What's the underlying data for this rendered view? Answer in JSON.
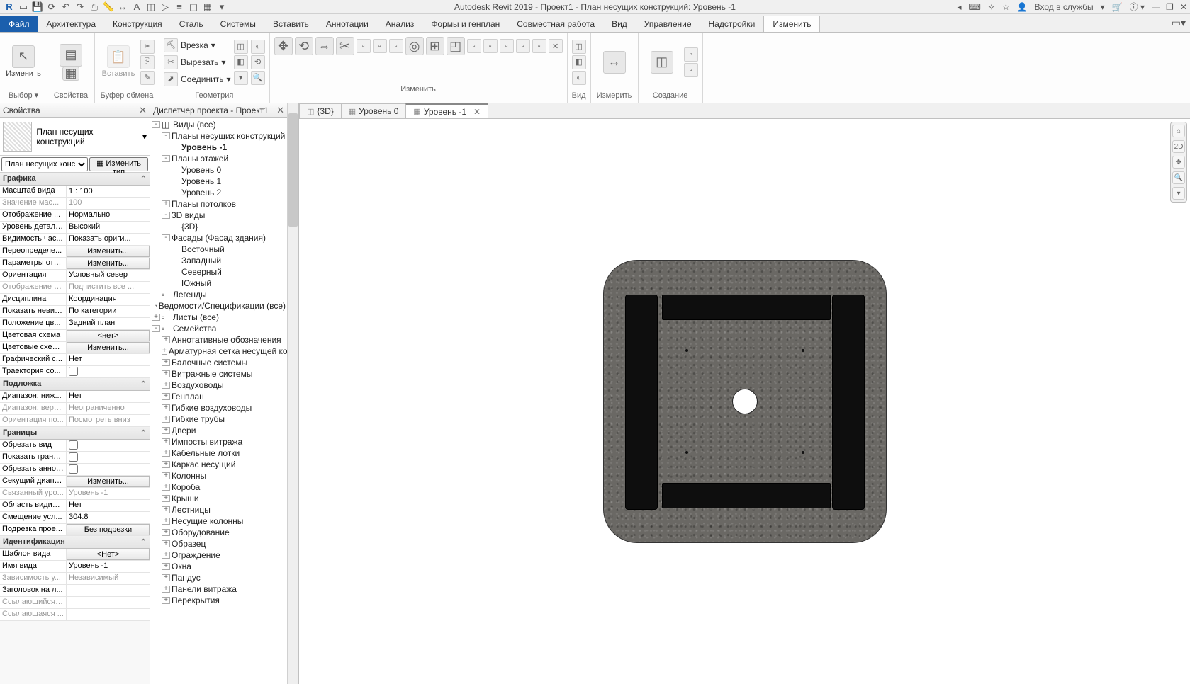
{
  "app": {
    "title": "Autodesk Revit 2019 - Проект1 - План несущих конструкций: Уровень -1",
    "sign_in": "Вход в службы"
  },
  "ribbon": {
    "file": "Файл",
    "tabs": [
      "Архитектура",
      "Конструкция",
      "Сталь",
      "Системы",
      "Вставить",
      "Аннотации",
      "Анализ",
      "Формы и генплан",
      "Совместная работа",
      "Вид",
      "Управление",
      "Надстройки",
      "Изменить"
    ],
    "active_tab": "Изменить",
    "groups": {
      "select": {
        "modify": "Изменить",
        "label": "Выбор"
      },
      "props": {
        "props": "Свойства",
        "label": "Свойства"
      },
      "clip": {
        "paste": "Вставить",
        "label": "Буфер обмена"
      },
      "geom": {
        "vrez": "Врезка",
        "cut": "Вырезать",
        "join": "Соединить",
        "label": "Геометрия"
      },
      "mod": {
        "label": "Изменить"
      },
      "view": {
        "label": "Вид"
      },
      "measure": {
        "label": "Измерить"
      },
      "create": {
        "label": "Создание"
      }
    }
  },
  "props_panel": {
    "title": "Свойства",
    "type_name": "План несущих конструкций",
    "type_sel": "План несущих конс",
    "edit_type": "Изменить тип",
    "groups": {
      "graphics": "Графика",
      "underlay": "Подложка",
      "extents": "Границы",
      "identity": "Идентификация"
    },
    "rows": {
      "scale": {
        "k": "Масштаб вида",
        "v": "1 : 100"
      },
      "scale_val": {
        "k": "Значение мас...",
        "v": "100"
      },
      "display": {
        "k": "Отображение ...",
        "v": "Нормально"
      },
      "detail": {
        "k": "Уровень детали...",
        "v": "Высокий"
      },
      "vis": {
        "k": "Видимость час...",
        "v": "Показать ориги..."
      },
      "override": {
        "k": "Переопределе...",
        "v": "Изменить..."
      },
      "params": {
        "k": "Параметры ото...",
        "v": "Изменить..."
      },
      "orient": {
        "k": "Ориентация",
        "v": "Условный север"
      },
      "wall_disp": {
        "k": "Отображение п...",
        "v": "Подчистить все ..."
      },
      "disc": {
        "k": "Дисциплина",
        "v": "Координация"
      },
      "hidden": {
        "k": "Показать невид...",
        "v": "По категории"
      },
      "color_pos": {
        "k": "Положение цв...",
        "v": "Задний план"
      },
      "color_scheme": {
        "k": "Цветовая схема",
        "v": "<нет>"
      },
      "color_schemes": {
        "k": "Цветовые схем...",
        "v": "Изменить..."
      },
      "graphic_s": {
        "k": "Графический с...",
        "v": "Нет"
      },
      "traject": {
        "k": "Траектория со...",
        "v": ""
      },
      "under_bot": {
        "k": "Диапазон: ниж...",
        "v": "Нет"
      },
      "under_top": {
        "k": "Диапазон: верх...",
        "v": "Неограниченно"
      },
      "under_orient": {
        "k": "Ориентация по...",
        "v": "Посмотреть вниз"
      },
      "crop": {
        "k": "Обрезать вид",
        "v": ""
      },
      "crop_show": {
        "k": "Показать грани...",
        "v": ""
      },
      "crop_ann": {
        "k": "Обрезать аннот...",
        "v": ""
      },
      "section": {
        "k": "Секущий диапа...",
        "v": "Изменить..."
      },
      "assoc": {
        "k": "Связанный уро...",
        "v": "Уровень -1"
      },
      "scope": {
        "k": "Область видим...",
        "v": "Нет"
      },
      "offset": {
        "k": "Смещение усл...",
        "v": "304.8"
      },
      "depth": {
        "k": "Подрезка прое...",
        "v": "Без подрезки"
      },
      "template": {
        "k": "Шаблон вида",
        "v": "<Нет>"
      },
      "view_name": {
        "k": "Имя вида",
        "v": "Уровень -1"
      },
      "depend": {
        "k": "Зависимость у...",
        "v": "Независимый"
      },
      "sheet_title": {
        "k": "Заголовок на л...",
        "v": ""
      },
      "ref1": {
        "k": "Ссылающийся ...",
        "v": ""
      },
      "ref2": {
        "k": "Ссылающаяся ...",
        "v": ""
      }
    }
  },
  "browser": {
    "title": "Диспетчер проекта - Проект1",
    "root": "Виды (все)",
    "items": [
      {
        "t": "Планы несущих конструкций",
        "lvl": 1,
        "exp": "-"
      },
      {
        "t": "Уровень -1",
        "lvl": 2,
        "sel": true
      },
      {
        "t": "Планы этажей",
        "lvl": 1,
        "exp": "-"
      },
      {
        "t": "Уровень 0",
        "lvl": 2
      },
      {
        "t": "Уровень 1",
        "lvl": 2
      },
      {
        "t": "Уровень 2",
        "lvl": 2
      },
      {
        "t": "Планы потолков",
        "lvl": 1,
        "exp": "+"
      },
      {
        "t": "3D виды",
        "lvl": 1,
        "exp": "-"
      },
      {
        "t": "{3D}",
        "lvl": 2
      },
      {
        "t": "Фасады (Фасад здания)",
        "lvl": 1,
        "exp": "-"
      },
      {
        "t": "Восточный",
        "lvl": 2
      },
      {
        "t": "Западный",
        "lvl": 2
      },
      {
        "t": "Северный",
        "lvl": 2
      },
      {
        "t": "Южный",
        "lvl": 2
      },
      {
        "t": "Легенды",
        "lvl": 0,
        "ico": true
      },
      {
        "t": "Ведомости/Спецификации (все)",
        "lvl": 0,
        "ico": true
      },
      {
        "t": "Листы (все)",
        "lvl": 0,
        "exp": "+",
        "ico": true
      },
      {
        "t": "Семейства",
        "lvl": 0,
        "exp": "-",
        "ico": true
      },
      {
        "t": "Аннотативные обозначения",
        "lvl": 1,
        "exp": "+"
      },
      {
        "t": "Арматурная сетка несущей конс",
        "lvl": 1,
        "exp": "+"
      },
      {
        "t": "Балочные системы",
        "lvl": 1,
        "exp": "+"
      },
      {
        "t": "Витражные системы",
        "lvl": 1,
        "exp": "+"
      },
      {
        "t": "Воздуховоды",
        "lvl": 1,
        "exp": "+"
      },
      {
        "t": "Генплан",
        "lvl": 1,
        "exp": "+"
      },
      {
        "t": "Гибкие воздуховоды",
        "lvl": 1,
        "exp": "+"
      },
      {
        "t": "Гибкие трубы",
        "lvl": 1,
        "exp": "+"
      },
      {
        "t": "Двери",
        "lvl": 1,
        "exp": "+"
      },
      {
        "t": "Импосты витража",
        "lvl": 1,
        "exp": "+"
      },
      {
        "t": "Кабельные лотки",
        "lvl": 1,
        "exp": "+"
      },
      {
        "t": "Каркас несущий",
        "lvl": 1,
        "exp": "+"
      },
      {
        "t": "Колонны",
        "lvl": 1,
        "exp": "+"
      },
      {
        "t": "Короба",
        "lvl": 1,
        "exp": "+"
      },
      {
        "t": "Крыши",
        "lvl": 1,
        "exp": "+"
      },
      {
        "t": "Лестницы",
        "lvl": 1,
        "exp": "+"
      },
      {
        "t": "Несущие колонны",
        "lvl": 1,
        "exp": "+"
      },
      {
        "t": "Оборудование",
        "lvl": 1,
        "exp": "+"
      },
      {
        "t": "Образец",
        "lvl": 1,
        "exp": "+"
      },
      {
        "t": "Ограждение",
        "lvl": 1,
        "exp": "+"
      },
      {
        "t": "Окна",
        "lvl": 1,
        "exp": "+"
      },
      {
        "t": "Пандус",
        "lvl": 1,
        "exp": "+"
      },
      {
        "t": "Панели витража",
        "lvl": 1,
        "exp": "+"
      },
      {
        "t": "Перекрытия",
        "lvl": 1,
        "exp": "+"
      }
    ]
  },
  "views": {
    "tabs": [
      {
        "name": "{3D}",
        "ico": "◫"
      },
      {
        "name": "Уровень 0",
        "ico": "▦"
      },
      {
        "name": "Уровень -1",
        "ico": "▦",
        "active": true
      }
    ]
  }
}
